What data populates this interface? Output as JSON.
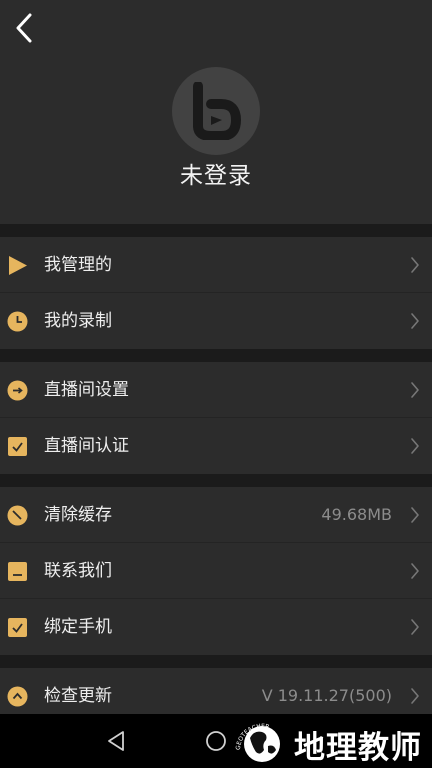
{
  "header": {
    "back_icon": "chevron-left-icon",
    "avatar_icon": "b-logo-icon",
    "login_status": "未登录"
  },
  "groups": [
    {
      "items": [
        {
          "label": "我管理的",
          "icon": "play-icon",
          "value": ""
        },
        {
          "label": "我的录制",
          "icon": "clock-icon",
          "value": ""
        }
      ]
    },
    {
      "items": [
        {
          "label": "直播间设置",
          "icon": "arrow-right-circle-icon",
          "value": ""
        },
        {
          "label": "直播间认证",
          "icon": "check-square-icon",
          "value": ""
        }
      ]
    },
    {
      "items": [
        {
          "label": "清除缓存",
          "icon": "broom-icon",
          "value": "49.68MB"
        },
        {
          "label": "联系我们",
          "icon": "minus-square-icon",
          "value": ""
        },
        {
          "label": "绑定手机",
          "icon": "check-square-icon",
          "value": ""
        }
      ]
    },
    {
      "items": [
        {
          "label": "检查更新",
          "icon": "chevron-up-circle-icon",
          "value": "V 19.11.27(500)"
        }
      ]
    }
  ],
  "navbar": {
    "back_icon": "triangle-back-icon",
    "home_icon": "circle-home-icon"
  },
  "watermark": {
    "text": "地理教师",
    "arc_text": "GEOTEACHER"
  },
  "colors": {
    "accent": "#e6b55e",
    "panel": "#2c2c2c",
    "gap": "#1b1b1b",
    "text": "#eeeeee",
    "muted": "#8c8c8c"
  }
}
